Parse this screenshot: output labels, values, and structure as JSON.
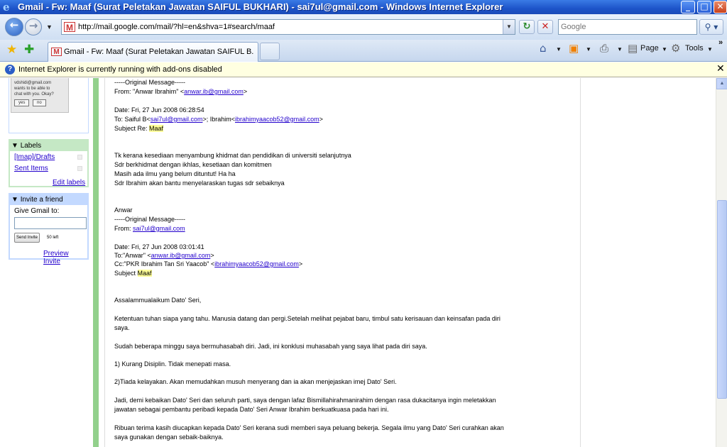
{
  "window": {
    "title": "Gmail - Fw: Maaf (Surat Peletakan Jawatan SAIFUL BUKHARI) - sai7ul@gmail.com - Windows Internet Explorer"
  },
  "nav": {
    "url": "http://mail.google.com/mail/?hl=en&shva=1#search/maaf",
    "search_placeholder": "Google"
  },
  "tabs": {
    "active_label": "Gmail - Fw: Maaf (Surat Peletakan Jawatan SAIFUL B..."
  },
  "commands": {
    "page_label": "Page",
    "tools_label": "Tools"
  },
  "infobar": {
    "message": "Internet Explorer is currently running with add-ons disabled"
  },
  "sidebar": {
    "chat_invite": {
      "line1": "vdshidi@gmail.com",
      "line2": "wants to be able to",
      "line3": "chat with you. Okay?",
      "yes_label": "yes",
      "no_label": "no"
    },
    "labels": {
      "header": "Labels",
      "items": [
        "[Imap]/Drafts",
        "Sent Items"
      ],
      "edit_label": "Edit labels"
    },
    "invite": {
      "header": "Invite a friend",
      "give_label": "Give Gmail to:",
      "send_label": "Send Invite",
      "remaining": "50 left",
      "preview_label": "Preview Invite"
    }
  },
  "mail": {
    "orig1": "-----Original Message-----",
    "from1_prefix": "From: \"Anwar Ibrahim\" <",
    "from1_email": "anwar.ib@gmail.com",
    "from1_suffix": ">",
    "date1": "Date: Fri, 27 Jun 2008 06:28:54",
    "to1_prefix": "To: Saiful B<",
    "to1_email1": "sai7ul@gmail.com",
    "to1_mid": ">; Ibrahim<",
    "to1_email2": "ibrahimyaacob52@gmail.com",
    "to1_suffix": ">",
    "subj1_prefix": "Subject Re: ",
    "subj1_word": "Maaf",
    "body1_l1": "Tk kerana kesediaan menyambung khidmat dan pendidikan di universiti selanjutnya",
    "body1_l2": "Sdr berkhidmat dengan ikhlas, kesetiaan dan komitmen",
    "body1_l3": "Masih ada ilmu yang belum dituntut! Ha ha",
    "body1_l4": "Sdr Ibrahim akan bantu menyelaraskan tugas sdr sebaiknya",
    "sign1": "Anwar",
    "orig2": "-----Original Message-----",
    "from2_prefix": "From: ",
    "from2_email": "sai7ul@gmail.com",
    "date2": "Date: Fri, 27 Jun 2008 03:01:41",
    "to2_prefix": "To:\"Anwar\" <",
    "to2_email": "anwar.ib@gmail.com",
    "to2_suffix": ">",
    "cc2_prefix": "Cc:\"PKR Ibrahim Tan Sri Yaacob\" <",
    "cc2_email": "ibrahimyaacob52@gmail.com",
    "cc2_suffix": ">",
    "subj2_prefix": "Subject ",
    "subj2_word": "Maaf",
    "greet": "Assalammualaikum Dato' Seri,",
    "p1_l1": "Ketentuan tuhan siapa yang tahu. Manusia datang dan pergi.Setelah melihat pejabat baru, timbul satu kerisauan dan keinsafan pada diri",
    "p1_l2": "saya.",
    "p2": "Sudah beberapa minggu saya  bermuhasabah diri. Jadi, ini konklusi muhasabah yang saya lihat pada diri saya.",
    "p3": "1) Kurang Disiplin. Tidak menepati masa.",
    "p4": "2)Tiada kelayakan. Akan memudahkan musuh menyerang dan ia akan menjejaskan imej Dato' Seri.",
    "p5_l1": "Jadi, demi kebaikan Dato' Seri dan seluruh parti, saya dengan lafaz Bismillahirahmanirahim dengan rasa dukacitanya ingin meletakkan",
    "p5_l2": "jawatan sebagai pembantu peribadi kepada Dato' Seri Anwar Ibrahim berkuatkuasa pada hari ini.",
    "p6_l1": "Ribuan terima kasih diucapkan kepada Dato' Seri kerana sudi memberi saya peluang bekerja. Segala ilmu yang Dato' Seri curahkan akan",
    "p6_l2": "saya gunakan dengan sebaik-baiknya."
  }
}
